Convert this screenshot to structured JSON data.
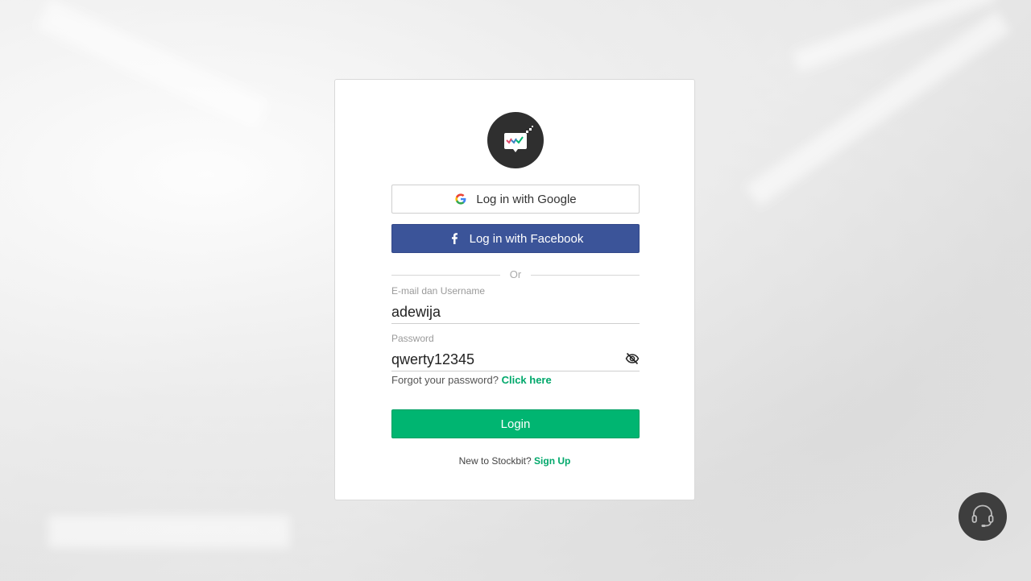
{
  "login": {
    "google_label": "Log in with Google",
    "facebook_label": "Log in with Facebook",
    "divider_text": "Or",
    "email": {
      "label": "E-mail dan Username",
      "value": "adewija"
    },
    "password": {
      "label": "Password",
      "value": "qwerty12345"
    },
    "forgot_text": "Forgot your password?",
    "forgot_link": "Click here",
    "login_label": "Login",
    "signup_text": "New to Stockbit?",
    "signup_link": "Sign Up"
  },
  "icons": {
    "logo": "stockbit-logo-icon",
    "google": "google-icon",
    "facebook": "facebook-icon",
    "eye": "eye-off-icon",
    "support": "headset-icon"
  },
  "colors": {
    "facebook": "#3b5499",
    "login": "#00b571",
    "link": "#00a86b",
    "logo_bg": "#2f2f2f",
    "support_bg": "#3e3e3e"
  }
}
